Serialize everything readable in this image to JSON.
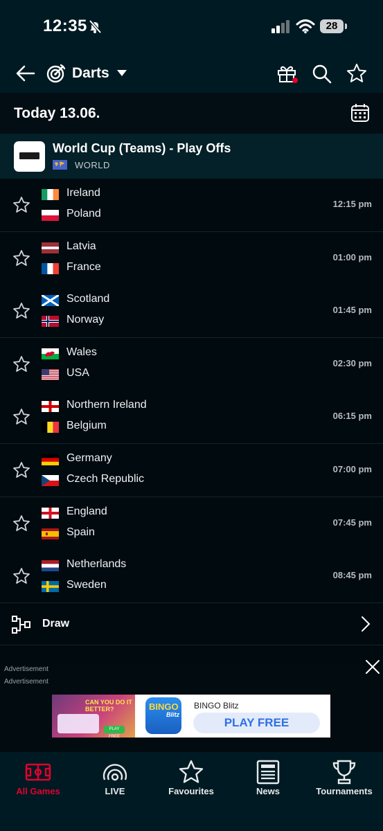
{
  "status_bar": {
    "time": "12:35",
    "battery": "28"
  },
  "header": {
    "sport": "Darts"
  },
  "date_bar": {
    "label": "Today 13.06."
  },
  "league": {
    "title": "World Cup (Teams) - Play Offs",
    "region": "WORLD"
  },
  "matches": [
    {
      "home": "Ireland",
      "away": "Poland",
      "time": "12:15 pm"
    },
    {
      "home": "Latvia",
      "away": "France",
      "time": "01:00 pm"
    },
    {
      "home": "Scotland",
      "away": "Norway",
      "time": "01:45 pm"
    },
    {
      "home": "Wales",
      "away": "USA",
      "time": "02:30 pm"
    },
    {
      "home": "Northern Ireland",
      "away": "Belgium",
      "time": "06:15 pm"
    },
    {
      "home": "Germany",
      "away": "Czech Republic",
      "time": "07:00 pm"
    },
    {
      "home": "England",
      "away": "Spain",
      "time": "07:45 pm"
    },
    {
      "home": "Netherlands",
      "away": "Sweden",
      "time": "08:45 pm"
    }
  ],
  "draw": {
    "label": "Draw"
  },
  "ad": {
    "label_top": "Advertisement",
    "label_bottom": "Advertisement",
    "headline": "CAN YOU DO IT BETTER?",
    "mini_cta": "PLAY FREE",
    "icon_line1": "BINGO",
    "icon_line2": "Blitz",
    "brand": "BINGO Blitz",
    "cta": "PLAY FREE"
  },
  "nav": {
    "items": [
      {
        "label": "All Games",
        "icon": "soccer-field-icon",
        "active": true
      },
      {
        "label": "LIVE",
        "icon": "live-broadcast-icon",
        "active": false
      },
      {
        "label": "Favourites",
        "icon": "star-icon",
        "active": false
      },
      {
        "label": "News",
        "icon": "newspaper-icon",
        "active": false
      },
      {
        "label": "Tournaments",
        "icon": "trophy-icon",
        "active": false
      }
    ]
  },
  "colors": {
    "accent": "#e3002d",
    "header_bg": "#001a23",
    "page_bg": "#010a0f"
  }
}
